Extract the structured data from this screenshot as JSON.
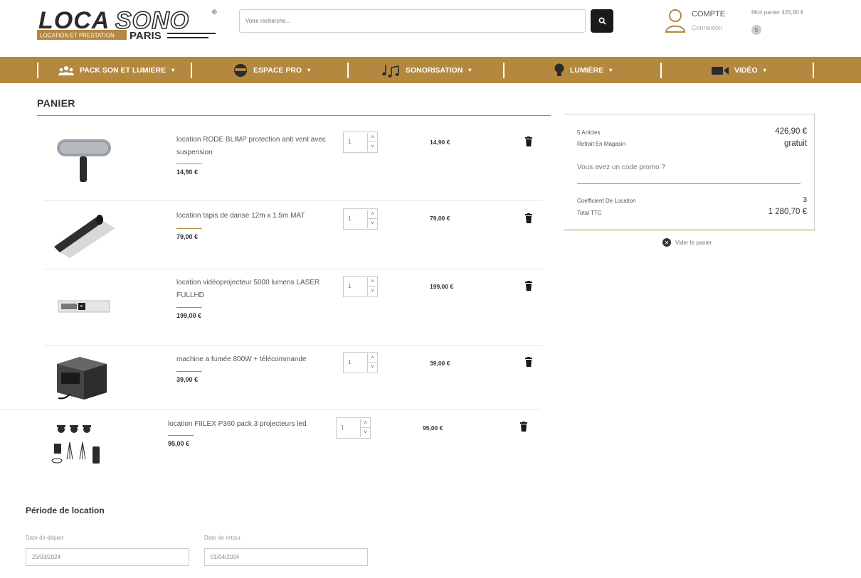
{
  "header": {
    "logo": {
      "brand": "LOCASONO",
      "tagline_left": "LOCATION ET PRESTATION",
      "tagline_right": "PARIS",
      "trademark": "®"
    },
    "search": {
      "placeholder": "Votre recherche...",
      "value": ""
    },
    "account": {
      "title": "COMPTE",
      "subtitle": "Connexion"
    },
    "cart": {
      "label": "Mon panier 426,90 €",
      "count": "5"
    }
  },
  "nav": {
    "items": [
      {
        "label": "PACK SON ET LUMIERE",
        "icon": "people-icon"
      },
      {
        "label": "ESPACE PRO",
        "icon": "mask-icon"
      },
      {
        "label": "SONORISATION",
        "icon": "music-note-icon"
      },
      {
        "label": "LUMIÈRE",
        "icon": "lightbulb-icon"
      },
      {
        "label": "VIDÉO",
        "icon": "video-camera-icon"
      }
    ]
  },
  "panier": {
    "title": "PANIER",
    "items": [
      {
        "name": "location RODE BLIMP protection anti vent avec suspension",
        "unit_price": "14,90 €",
        "quantity": "1",
        "total": "14,90 €"
      },
      {
        "name": "location tapis de danse 12m x 1.5m MAT",
        "unit_price": "79,00 €",
        "quantity": "1",
        "total": "79,00 €"
      },
      {
        "name": "location vidéoprojecteur 5000 lumens LASER FULLHD",
        "unit_price": "199,00 €",
        "quantity": "1",
        "total": "199,00 €"
      },
      {
        "name": "machine a fumée 800W + télécommande",
        "unit_price": "39,00 €",
        "quantity": "1",
        "total": "39,00 €"
      },
      {
        "name": "location FIILEX P360 pack 3 projecteurs led",
        "unit_price": "95,00 €",
        "quantity": "1",
        "total": "95,00 €"
      }
    ]
  },
  "summary": {
    "articles_label": "5 Articles",
    "articles_value": "426,90 €",
    "pickup_label": "Retrait En Magasin",
    "pickup_value": "gratuit",
    "promo": "Vous avez un code promo ?",
    "coef_label": "Coefficient De Location",
    "coef_value": "3",
    "total_label": "Total TTC",
    "total_value": "1 280,70 €",
    "clear_label": "Vider le panier"
  },
  "periode": {
    "title": "Période de location",
    "depart_label": "Date de départ",
    "depart_value": "25/03/2024",
    "retour_label": "Date de retour",
    "retour_value": "01/04/2024"
  },
  "colors": {
    "accent": "#b4883e",
    "dark": "#1a1a1a"
  }
}
